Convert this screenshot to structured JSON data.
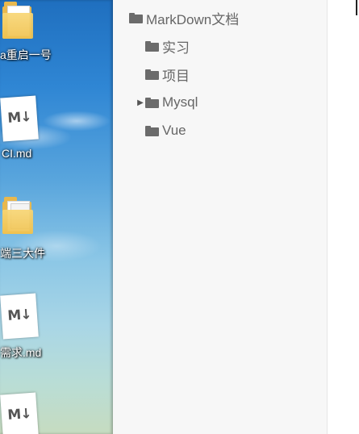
{
  "desktop": {
    "items": [
      {
        "type": "folder",
        "label": "a重启一号",
        "icon": "folder-icon"
      },
      {
        "type": "markdown",
        "label": "CI.md",
        "icon": "markdown-file-icon"
      },
      {
        "type": "folder",
        "label": "端三大件",
        "icon": "folder-icon"
      },
      {
        "type": "markdown",
        "label": "需求.md",
        "icon": "markdown-file-icon"
      },
      {
        "type": "markdown",
        "label": "",
        "icon": "markdown-file-icon"
      }
    ],
    "md_glyph": "M↓"
  },
  "sidebar": {
    "root": {
      "label": "MarkDown文档",
      "icon": "folder-icon"
    },
    "children": [
      {
        "label": "实习",
        "icon": "folder-icon",
        "collapsed_arrow": ""
      },
      {
        "label": "项目",
        "icon": "folder-icon",
        "collapsed_arrow": ""
      },
      {
        "label": "Mysql",
        "icon": "folder-icon",
        "collapsed_arrow": "▶"
      },
      {
        "label": "Vue",
        "icon": "folder-icon",
        "collapsed_arrow": ""
      }
    ]
  }
}
